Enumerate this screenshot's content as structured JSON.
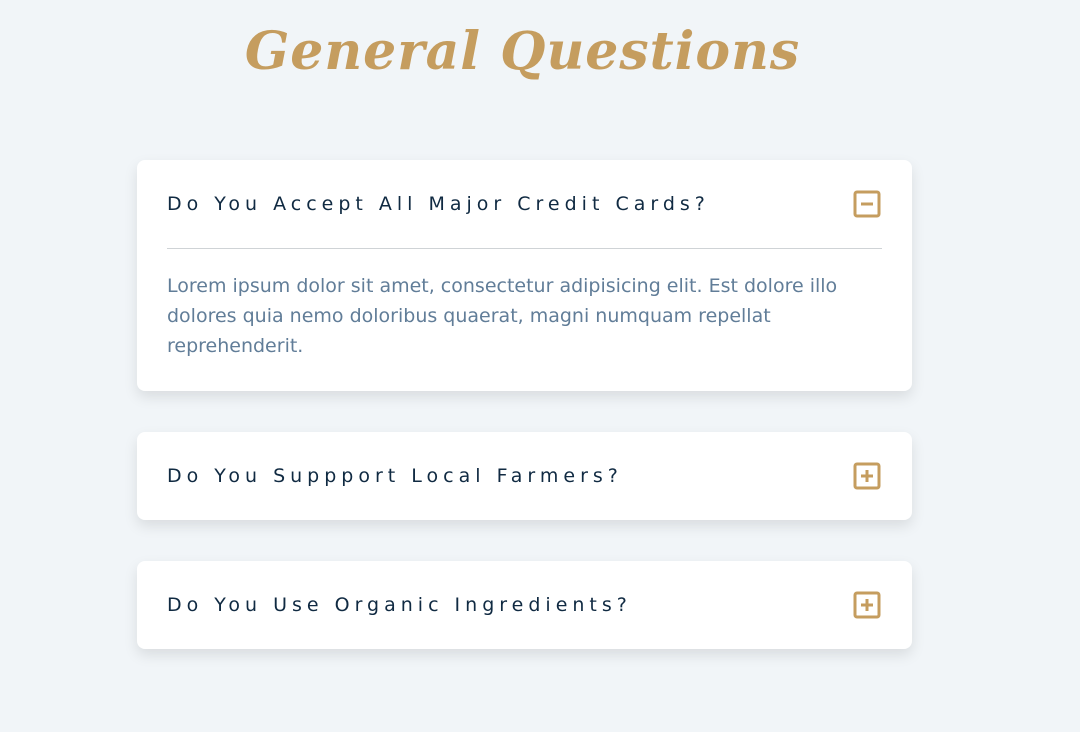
{
  "page": {
    "title": "General Questions"
  },
  "colors": {
    "background": "#f1f5f8",
    "accent": "#c59d5f",
    "question_text": "#102a42",
    "answer_text": "#617d98",
    "card": "#ffffff"
  },
  "questions": [
    {
      "title": "Do You Accept All Major Credit Cards?",
      "expanded": true,
      "toggle_icon": "minus-square-icon",
      "answer": "Lorem ipsum dolor sit amet, consectetur adipisicing elit. Est dolore illo dolores quia nemo doloribus quaerat, magni numquam repellat reprehenderit."
    },
    {
      "title": "Do You Suppport Local Farmers?",
      "expanded": false,
      "toggle_icon": "plus-square-icon"
    },
    {
      "title": "Do You Use Organic Ingredients?",
      "expanded": false,
      "toggle_icon": "plus-square-icon"
    }
  ]
}
